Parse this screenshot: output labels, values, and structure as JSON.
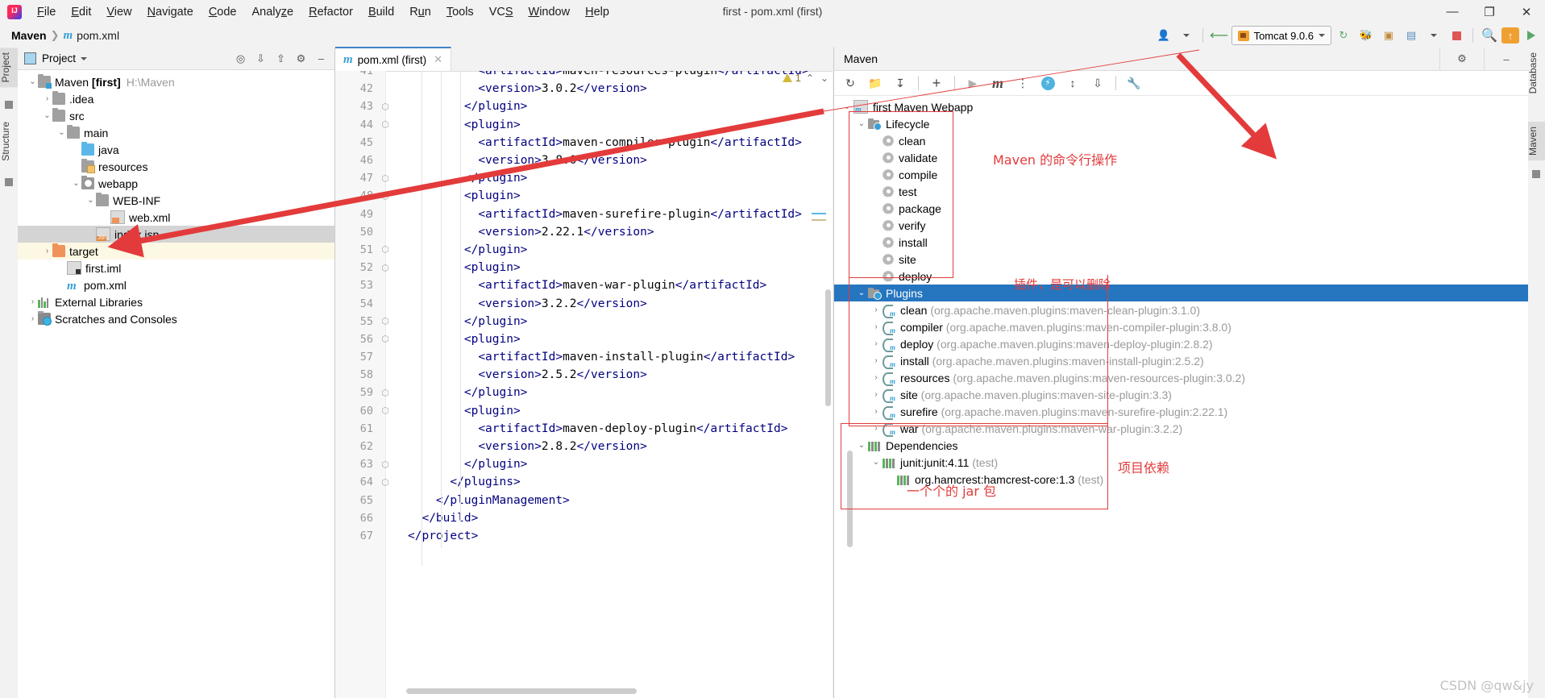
{
  "window": {
    "title": "first - pom.xml (first)",
    "controls": {
      "minimize": "—",
      "maximize": "❐",
      "close": "✕"
    }
  },
  "menubar": [
    {
      "label": "File"
    },
    {
      "label": "Edit"
    },
    {
      "label": "View"
    },
    {
      "label": "Navigate"
    },
    {
      "label": "Code"
    },
    {
      "label": "Analyze"
    },
    {
      "label": "Refactor"
    },
    {
      "label": "Build"
    },
    {
      "label": "Run"
    },
    {
      "label": "Tools"
    },
    {
      "label": "VCS"
    },
    {
      "label": "Window"
    },
    {
      "label": "Help"
    }
  ],
  "navbar": {
    "project": "Maven",
    "separator": "❯",
    "file": "pom.xml",
    "run_config": "Tomcat 9.0.6",
    "icons": {
      "profile": "user-icon",
      "build": "hammer-icon",
      "rerun": "rerun-icon",
      "debug": "debug-icon",
      "coverage": "coverage-icon",
      "more": "more-icon",
      "stop": "stop-icon",
      "search": "search-icon",
      "update": "update-icon",
      "run": "run-icon"
    }
  },
  "left_strip": {
    "tabs": [
      "Project",
      "Structure"
    ]
  },
  "right_strip": {
    "tabs": [
      "Database",
      "Maven"
    ]
  },
  "project_panel": {
    "title": "Project",
    "toolbar_icons": [
      "locate-icon",
      "expand-all-icon",
      "collapse-all-icon",
      "gear-icon",
      "minimize-icon"
    ],
    "tree": [
      {
        "label": "Maven",
        "bold_suffix": "[first]",
        "path": "H:\\Maven",
        "depth": 0,
        "arrow": "⌄",
        "icon": "module-folder-icon"
      },
      {
        "label": ".idea",
        "depth": 1,
        "arrow": "›",
        "icon": "folder-icon"
      },
      {
        "label": "src",
        "depth": 1,
        "arrow": "⌄",
        "icon": "folder-icon"
      },
      {
        "label": "main",
        "depth": 2,
        "arrow": "⌄",
        "icon": "folder-icon"
      },
      {
        "label": "java",
        "depth": 3,
        "arrow": "",
        "icon": "source-folder-icon"
      },
      {
        "label": "resources",
        "depth": 3,
        "arrow": "",
        "icon": "resources-folder-icon"
      },
      {
        "label": "webapp",
        "depth": 3,
        "arrow": "⌄",
        "icon": "web-folder-icon"
      },
      {
        "label": "WEB-INF",
        "depth": 4,
        "arrow": "⌄",
        "icon": "folder-icon"
      },
      {
        "label": "web.xml",
        "depth": 5,
        "arrow": "",
        "icon": "xml-file-icon"
      },
      {
        "label": "index.jsp",
        "depth": 4,
        "arrow": "",
        "icon": "jsp-file-icon",
        "state": "selected"
      },
      {
        "label": "target",
        "depth": 1,
        "arrow": "›",
        "icon": "excluded-folder-icon",
        "state": "highlighted"
      },
      {
        "label": "first.iml",
        "depth": 2,
        "arrow": "",
        "icon": "iml-file-icon"
      },
      {
        "label": "pom.xml",
        "depth": 2,
        "arrow": "",
        "icon": "maven-file-icon"
      },
      {
        "label": "External Libraries",
        "depth": 0,
        "arrow": "›",
        "icon": "libraries-icon"
      },
      {
        "label": "Scratches and Consoles",
        "depth": 0,
        "arrow": "›",
        "icon": "scratches-icon"
      }
    ]
  },
  "editor": {
    "tab": {
      "label": "pom.xml (first)",
      "icon": "maven-file-icon",
      "close": "✕"
    },
    "inspection": {
      "count": "1",
      "icon": "warning-icon",
      "up": "⌃",
      "down": "⌄"
    },
    "lines": [
      {
        "n": "41",
        "text": "<artifactId>maven-resources-plugin</artifactId>",
        "indent": 10,
        "partial": true
      },
      {
        "n": "42",
        "text": "<version>3.0.2</version>",
        "indent": 10
      },
      {
        "n": "43",
        "text": "</plugin>",
        "indent": 8,
        "fold": "⬡"
      },
      {
        "n": "44",
        "text": "<plugin>",
        "indent": 8,
        "fold": "⬡"
      },
      {
        "n": "45",
        "text": "<artifactId>maven-compiler-plugin</artifactId>",
        "indent": 10
      },
      {
        "n": "46",
        "text": "<version>3.8.0</version>",
        "indent": 10
      },
      {
        "n": "47",
        "text": "</plugin>",
        "indent": 8,
        "fold": "⬡"
      },
      {
        "n": "48",
        "text": "<plugin>",
        "indent": 8,
        "fold": "⬡"
      },
      {
        "n": "49",
        "text": "<artifactId>maven-surefire-plugin</artifactId>",
        "indent": 10
      },
      {
        "n": "50",
        "text": "<version>2.22.1</version>",
        "indent": 10
      },
      {
        "n": "51",
        "text": "</plugin>",
        "indent": 8,
        "fold": "⬡"
      },
      {
        "n": "52",
        "text": "<plugin>",
        "indent": 8,
        "fold": "⬡"
      },
      {
        "n": "53",
        "text": "<artifactId>maven-war-plugin</artifactId>",
        "indent": 10
      },
      {
        "n": "54",
        "text": "<version>3.2.2</version>",
        "indent": 10
      },
      {
        "n": "55",
        "text": "</plugin>",
        "indent": 8,
        "fold": "⬡"
      },
      {
        "n": "56",
        "text": "<plugin>",
        "indent": 8,
        "fold": "⬡"
      },
      {
        "n": "57",
        "text": "<artifactId>maven-install-plugin</artifactId>",
        "indent": 10
      },
      {
        "n": "58",
        "text": "<version>2.5.2</version>",
        "indent": 10
      },
      {
        "n": "59",
        "text": "</plugin>",
        "indent": 8,
        "fold": "⬡"
      },
      {
        "n": "60",
        "text": "<plugin>",
        "indent": 8,
        "fold": "⬡"
      },
      {
        "n": "61",
        "text": "<artifactId>maven-deploy-plugin</artifactId>",
        "indent": 10
      },
      {
        "n": "62",
        "text": "<version>2.8.2</version>",
        "indent": 10
      },
      {
        "n": "63",
        "text": "</plugin>",
        "indent": 8,
        "fold": "⬡"
      },
      {
        "n": "64",
        "text": "</plugins>",
        "indent": 6,
        "fold": "⬡"
      },
      {
        "n": "65",
        "text": "</pluginManagement>",
        "indent": 4
      },
      {
        "n": "66",
        "text": "</build>",
        "indent": 2
      },
      {
        "n": "67",
        "text": "</project>",
        "indent": 0
      }
    ]
  },
  "maven_panel": {
    "title": "Maven",
    "toolbar_icons": [
      "refresh-icon",
      "add-module-icon",
      "download-sources-icon",
      "add-icon",
      "run-icon",
      "execute-goal-icon",
      "toggle-skip-tests-icon",
      "toggle-offline-icon",
      "expand-all-icon",
      "collapse-all-icon",
      "settings-icon"
    ],
    "tree": {
      "root": {
        "label": "first Maven Webapp",
        "arrow": "⌄",
        "icon": "maven-project-icon"
      },
      "lifecycle": {
        "label": "Lifecycle",
        "arrow": "⌄",
        "icon": "lifecycle-folder-icon",
        "goals": [
          "clean",
          "validate",
          "compile",
          "test",
          "package",
          "verify",
          "install",
          "site",
          "deploy"
        ]
      },
      "plugins": {
        "label": "Plugins",
        "arrow": "⌄",
        "icon": "plugins-folder-icon",
        "selected": true,
        "items": [
          {
            "name": "clean",
            "coords": "(org.apache.maven.plugins:maven-clean-plugin:3.1.0)"
          },
          {
            "name": "compiler",
            "coords": "(org.apache.maven.plugins:maven-compiler-plugin:3.8.0)"
          },
          {
            "name": "deploy",
            "coords": "(org.apache.maven.plugins:maven-deploy-plugin:2.8.2)"
          },
          {
            "name": "install",
            "coords": "(org.apache.maven.plugins:maven-install-plugin:2.5.2)"
          },
          {
            "name": "resources",
            "coords": "(org.apache.maven.plugins:maven-resources-plugin:3.0.2)"
          },
          {
            "name": "site",
            "coords": "(org.apache.maven.plugins:maven-site-plugin:3.3)"
          },
          {
            "name": "surefire",
            "coords": "(org.apache.maven.plugins:maven-surefire-plugin:2.22.1)"
          },
          {
            "name": "war",
            "coords": "(org.apache.maven.plugins:maven-war-plugin:3.2.2)"
          }
        ]
      },
      "dependencies": {
        "label": "Dependencies",
        "arrow": "⌄",
        "icon": "dependencies-icon",
        "items": [
          {
            "label": "junit:junit:4.11",
            "scope": "(test)",
            "arrow": "⌄",
            "depth": 1
          },
          {
            "label": "org.hamcrest:hamcrest-core:1.3",
            "scope": "(test)",
            "arrow": "",
            "depth": 2
          }
        ]
      }
    }
  },
  "annotations": {
    "lifecycle_note": "Maven 的命令行操作",
    "plugins_note": "插件，是可以删除",
    "dependencies_note": "项目依赖",
    "jar_note": "一个个的 jar 包"
  },
  "watermark": "CSDN @qw&jy"
}
